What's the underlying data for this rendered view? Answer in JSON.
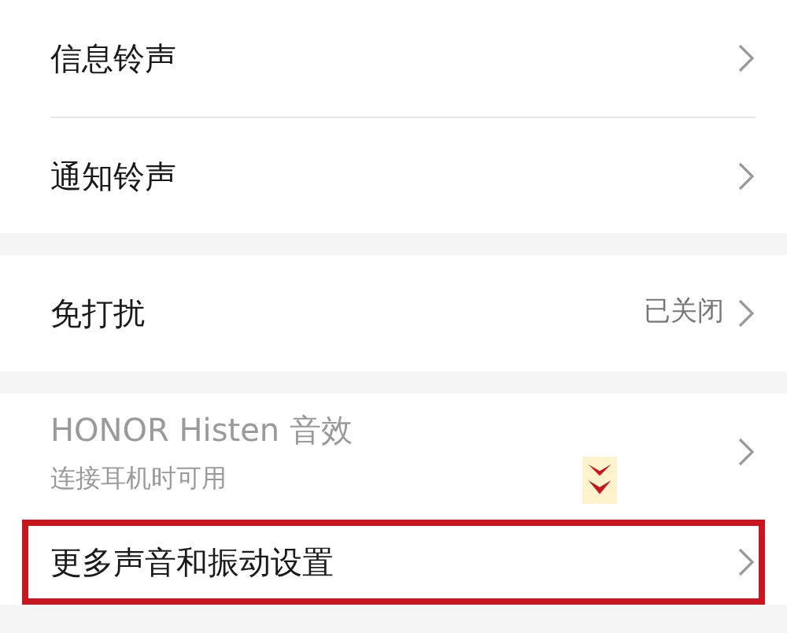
{
  "groups": [
    {
      "items": [
        {
          "title": "信息铃声",
          "disabled": false,
          "highlighted": false
        },
        {
          "title": "通知铃声",
          "disabled": false,
          "highlighted": false
        }
      ]
    },
    {
      "items": [
        {
          "title": "免打扰",
          "value": "已关闭",
          "disabled": false,
          "highlighted": false
        }
      ]
    },
    {
      "items": [
        {
          "title": "HONOR Histen 音效",
          "subtitle": "连接耳机时可用",
          "disabled": true,
          "highlighted": false
        },
        {
          "title": "更多声音和振动设置",
          "disabled": false,
          "highlighted": true
        }
      ]
    }
  ]
}
